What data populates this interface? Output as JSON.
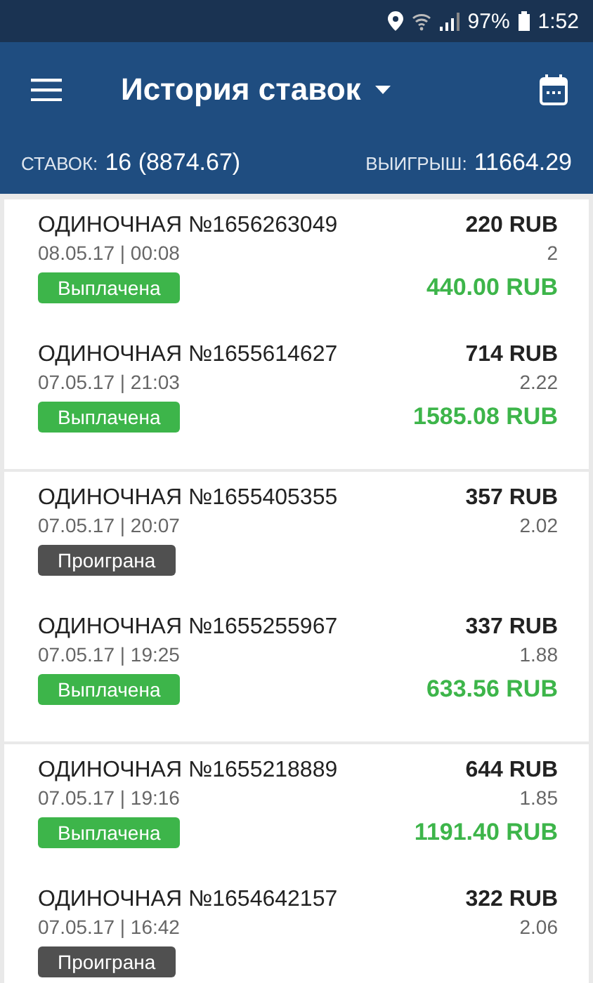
{
  "status_bar": {
    "battery": "97%",
    "time": "1:52"
  },
  "header": {
    "title": "История ставок"
  },
  "summary": {
    "bets_label": "СТАВОК:",
    "bets_value": "16 (8874.67)",
    "win_label": "ВЫИГРЫШ:",
    "win_value": "11664.29"
  },
  "groups": [
    {
      "bets": [
        {
          "title": "ОДИНОЧНАЯ №1656263049",
          "datetime": "08.05.17 | 00:08",
          "stake": "220 RUB",
          "odds": "2",
          "status": "Выплачена",
          "kind": "won",
          "payout": "440.00 RUB"
        },
        {
          "title": "ОДИНОЧНАЯ №1655614627",
          "datetime": "07.05.17 | 21:03",
          "stake": "714 RUB",
          "odds": "2.22",
          "status": "Выплачена",
          "kind": "won",
          "payout": "1585.08 RUB"
        }
      ]
    },
    {
      "bets": [
        {
          "title": "ОДИНОЧНАЯ №1655405355",
          "datetime": "07.05.17 | 20:07",
          "stake": "357 RUB",
          "odds": "2.02",
          "status": "Проиграна",
          "kind": "lost"
        },
        {
          "title": "ОДИНОЧНАЯ №1655255967",
          "datetime": "07.05.17 | 19:25",
          "stake": "337 RUB",
          "odds": "1.88",
          "status": "Выплачена",
          "kind": "won",
          "payout": "633.56 RUB"
        }
      ]
    },
    {
      "bets": [
        {
          "title": "ОДИНОЧНАЯ №1655218889",
          "datetime": "07.05.17 | 19:16",
          "stake": "644 RUB",
          "odds": "1.85",
          "status": "Выплачена",
          "kind": "won",
          "payout": "1191.40 RUB"
        },
        {
          "title": "ОДИНОЧНАЯ №1654642157",
          "datetime": "07.05.17 | 16:42",
          "stake": "322 RUB",
          "odds": "2.06",
          "status": "Проиграна",
          "kind": "lost"
        }
      ]
    }
  ]
}
